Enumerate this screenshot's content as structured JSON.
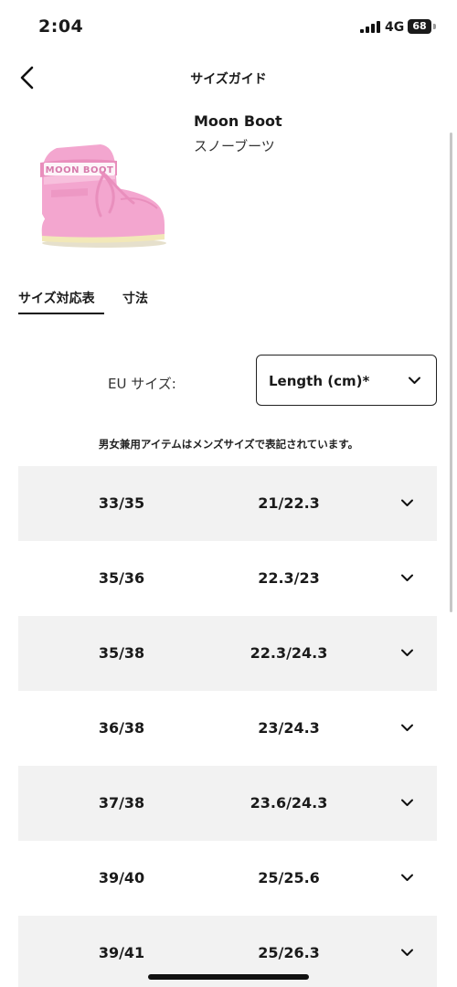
{
  "status_bar": {
    "time": "2:04",
    "network": "4G",
    "battery": "68"
  },
  "header": {
    "title": "サイズガイド"
  },
  "product": {
    "name": "Moon Boot",
    "subtitle": "スノーブーツ",
    "boot_text": "MOON BOOT"
  },
  "tabs": [
    {
      "label": "サイズ対応表",
      "active": true
    },
    {
      "label": "寸法",
      "active": false
    }
  ],
  "size_selector": {
    "eu_label": "EU サイズ:",
    "unit_value": "Length (cm)*"
  },
  "note": "男女兼用アイテムはメンズサイズで表記されています。",
  "rows": [
    {
      "eu": "33/35",
      "length": "21/22.3"
    },
    {
      "eu": "35/36",
      "length": "22.3/23"
    },
    {
      "eu": "35/38",
      "length": "22.3/24.3"
    },
    {
      "eu": "36/38",
      "length": "23/24.3"
    },
    {
      "eu": "37/38",
      "length": "23.6/24.3"
    },
    {
      "eu": "39/40",
      "length": "25/25.6"
    },
    {
      "eu": "39/41",
      "length": "25/26.3"
    }
  ],
  "colors": {
    "row_shade": "#f2f2f2",
    "boot_pink": "#f3a6cf",
    "text": "#1a1a1a"
  },
  "icons": {
    "back": "chevron-left-icon",
    "expand": "chevron-down-icon"
  }
}
